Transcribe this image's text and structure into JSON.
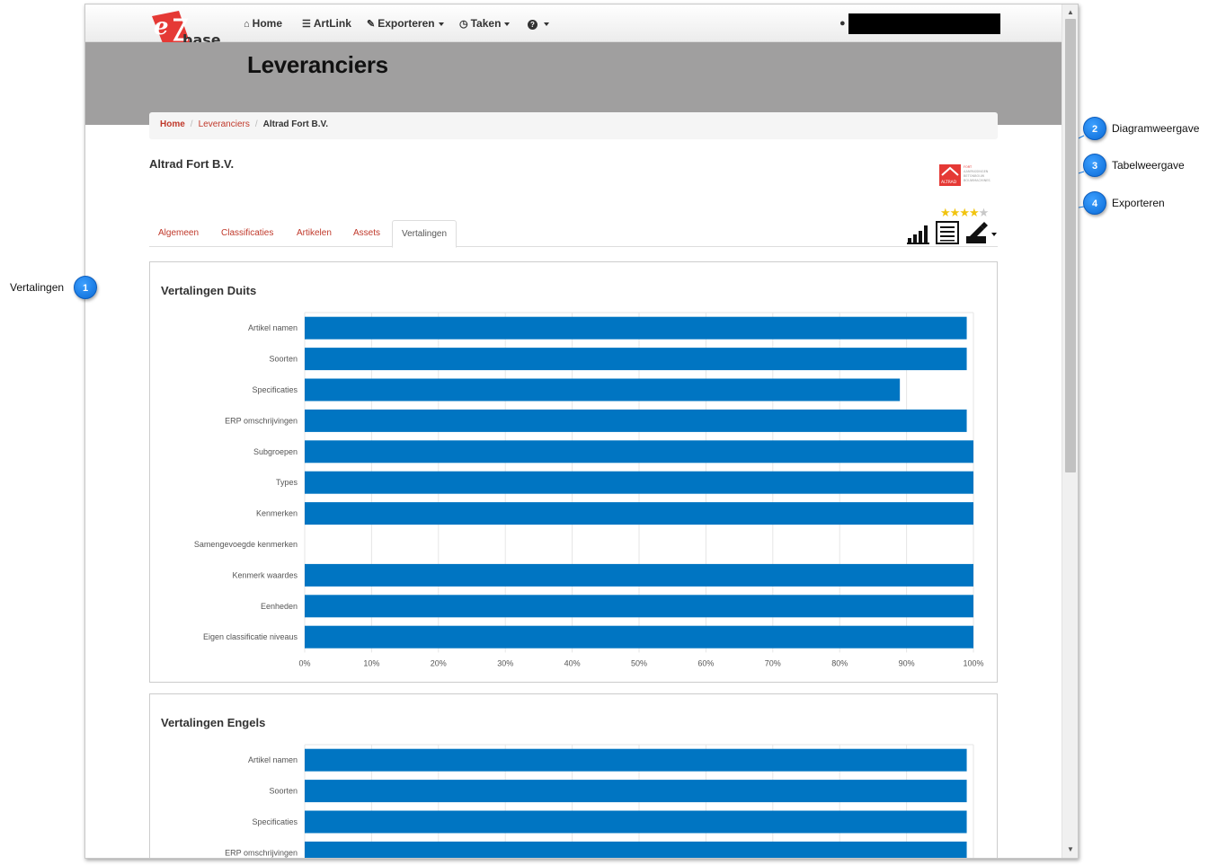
{
  "nav": {
    "logo_text": "base",
    "items": [
      {
        "label": "Home",
        "icon": "home-icon",
        "caret": false
      },
      {
        "label": "ArtLink",
        "icon": "list-icon",
        "caret": false
      },
      {
        "label": "Exporteren",
        "icon": "export-icon",
        "caret": true
      },
      {
        "label": "Taken",
        "icon": "clock-icon",
        "caret": true
      },
      {
        "label": "",
        "icon": "help-icon",
        "caret": true
      }
    ]
  },
  "page_title": "Leveranciers",
  "breadcrumb": [
    "Home",
    "Leveranciers",
    "Altrad Fort B.V."
  ],
  "supplier": {
    "name": "Altrad Fort B.V.",
    "logo_text": "ALTRAD",
    "logo_side_lines": [
      "FORT",
      "AANPASSINGEN",
      "BETONBOUW",
      "BOUWMACHINES"
    ],
    "rating": 4,
    "rating_max": 5
  },
  "tabs": [
    "Algemeen",
    "Classificaties",
    "Artikelen",
    "Assets",
    "Vertalingen"
  ],
  "active_tab": "Vertalingen",
  "toolbar": {
    "chart_view_icon": "bar-chart-icon",
    "table_view_icon": "table-icon",
    "export_icon": "export-icon"
  },
  "callouts": [
    {
      "number": "1",
      "label": "Vertalingen"
    },
    {
      "number": "2",
      "label": "Diagramweergave"
    },
    {
      "number": "3",
      "label": "Tabelweergave"
    },
    {
      "number": "4",
      "label": "Exporteren"
    }
  ],
  "colors": {
    "bar": "#0075c2",
    "link": "#c0392b",
    "header_band": "#a09f9f",
    "callout": "#1a7fe8"
  },
  "chart_data": [
    {
      "type": "bar",
      "orientation": "horizontal",
      "title": "Vertalingen Duits",
      "categories": [
        "Artikel namen",
        "Soorten",
        "Specificaties",
        "ERP omschrijvingen",
        "Subgroepen",
        "Types",
        "Kenmerken",
        "Samengevoegde kenmerken",
        "Kenmerk waardes",
        "Eenheden",
        "Eigen classificatie niveaus"
      ],
      "values": [
        99,
        99,
        89,
        99,
        100,
        100,
        100,
        0,
        100,
        100,
        100
      ],
      "xlim": [
        0,
        100
      ],
      "x_ticks": [
        "0%",
        "10%",
        "20%",
        "30%",
        "40%",
        "50%",
        "60%",
        "70%",
        "80%",
        "90%",
        "100%"
      ],
      "grid": true
    },
    {
      "type": "bar",
      "orientation": "horizontal",
      "title": "Vertalingen Engels",
      "categories": [
        "Artikel namen",
        "Soorten",
        "Specificaties",
        "ERP omschrijvingen"
      ],
      "values": [
        99,
        99,
        99,
        99
      ],
      "xlim": [
        0,
        100
      ],
      "grid": true
    }
  ]
}
